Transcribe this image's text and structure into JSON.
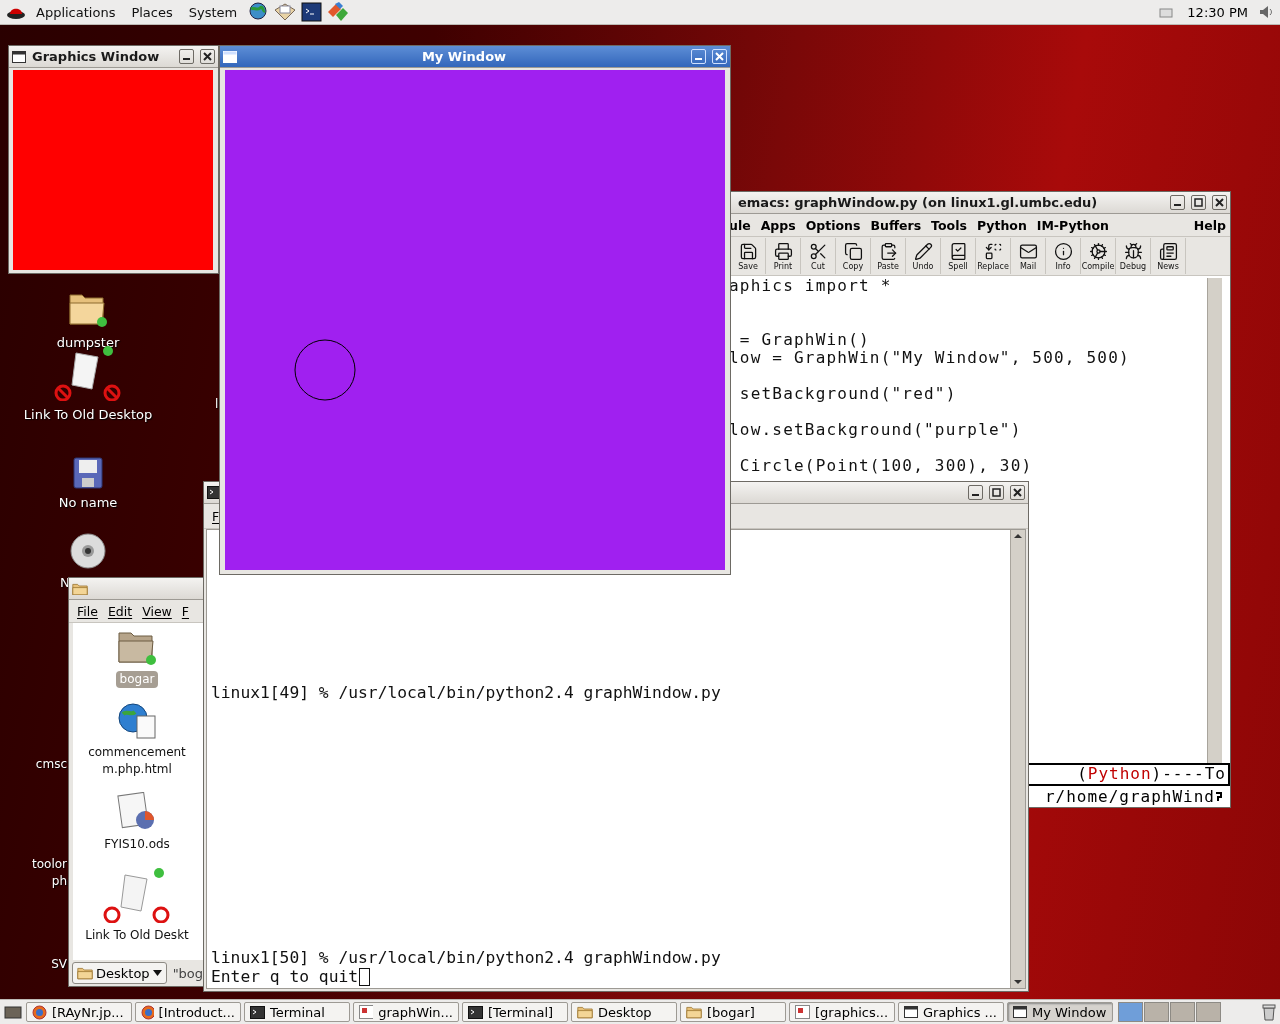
{
  "top_panel": {
    "menus": [
      "Applications",
      "Places",
      "System"
    ],
    "launchers": [
      {
        "kind": "browser"
      },
      {
        "kind": "mail"
      },
      {
        "kind": "terminal"
      },
      {
        "kind": "tool"
      }
    ],
    "clock": "12:30 PM"
  },
  "desktop_icons": [
    {
      "label": "dumpster",
      "kind": "folder"
    },
    {
      "label": "Link To Old Desktop",
      "kind": "link"
    },
    {
      "label": "No name",
      "kind": "floppy"
    },
    {
      "label": "N",
      "kind": "disc"
    }
  ],
  "desktop_fragments": [
    "l",
    "cmsc",
    "toolor",
    "ph",
    "SV"
  ],
  "graphics_window": {
    "title": "Graphics Window"
  },
  "file_manager": {
    "menus": [
      "File",
      "Edit",
      "View",
      "F"
    ],
    "items": [
      {
        "lines": [
          "bogar"
        ],
        "kind": "folder",
        "selected": true
      },
      {
        "lines": [
          "commencement",
          "m.php.html"
        ],
        "kind": "html",
        "selected": false
      },
      {
        "lines": [
          "FYIS10.ods"
        ],
        "kind": "sheet",
        "selected": false
      },
      {
        "lines": [
          "Link To Old Deskt"
        ],
        "kind": "link",
        "selected": false
      }
    ],
    "location": "Desktop",
    "path": "\"bog"
  },
  "emacs": {
    "title": "emacs: graphWindow.py (on linux1.gl.umbc.edu)",
    "menus": [
      "ule",
      "Apps",
      "Options",
      "Buffers",
      "Tools",
      "Python",
      "IM-Python"
    ],
    "help": "Help",
    "toolbar": [
      {
        "label": "Save",
        "kind": "save"
      },
      {
        "label": "Print",
        "kind": "print"
      },
      {
        "label": "Cut",
        "kind": "cut"
      },
      {
        "label": "Copy",
        "kind": "copy"
      },
      {
        "label": "Paste",
        "kind": "paste"
      },
      {
        "label": "Undo",
        "kind": "undo"
      },
      {
        "label": "Spell",
        "kind": "spell"
      },
      {
        "label": "Replace",
        "kind": "replace"
      },
      {
        "label": "Mail",
        "kind": "mail"
      },
      {
        "label": "Info",
        "kind": "info"
      },
      {
        "label": "Compile",
        "kind": "compile"
      },
      {
        "label": "Debug",
        "kind": "debug"
      },
      {
        "label": "News",
        "kind": "news"
      }
    ],
    "code_blocks": [
      [
        "aphics import *"
      ],
      [
        " = GraphWin()",
        "low = GraphWin(\"My Window\", 500, 500)"
      ],
      [
        " setBackground(\"red\")"
      ],
      [
        "low.setBackground(\"purple\")"
      ],
      [
        " Circle(Point(100, 300), 30)"
      ]
    ],
    "mode_line": [
      {
        "text": "(",
        "mode": false
      },
      {
        "text": "Python",
        "mode": true
      },
      {
        "text": ")----To",
        "mode": false
      }
    ],
    "minibuffer": "r/home/graphWind"
  },
  "terminal": {
    "menu": "F",
    "blocks": [
      [
        "linux1[49] % /usr/local/bin/python2.4 graphWindow.py"
      ],
      [
        "linux1[50] % /usr/local/bin/python2.4 graphWindow.py",
        "Enter q to quit"
      ]
    ]
  },
  "my_window": {
    "title": "My Window"
  },
  "taskbar": [
    {
      "label": "[RAyNr.jp...",
      "kind": "browser",
      "selected": false
    },
    {
      "label": "[Introduct...",
      "kind": "browser",
      "selected": false
    },
    {
      "label": "Terminal",
      "kind": "terminal",
      "selected": false
    },
    {
      "label": "graphWin...",
      "kind": "document",
      "selected": false
    },
    {
      "label": "[Terminal]",
      "kind": "terminal",
      "selected": false
    },
    {
      "label": "Desktop",
      "kind": "folder",
      "selected": false
    },
    {
      "label": "[bogar]",
      "kind": "folder",
      "selected": false
    },
    {
      "label": "[graphics...",
      "kind": "document",
      "selected": false
    },
    {
      "label": "Graphics ...",
      "kind": "window",
      "selected": false
    },
    {
      "label": "My Window",
      "kind": "window",
      "selected": true
    }
  ]
}
